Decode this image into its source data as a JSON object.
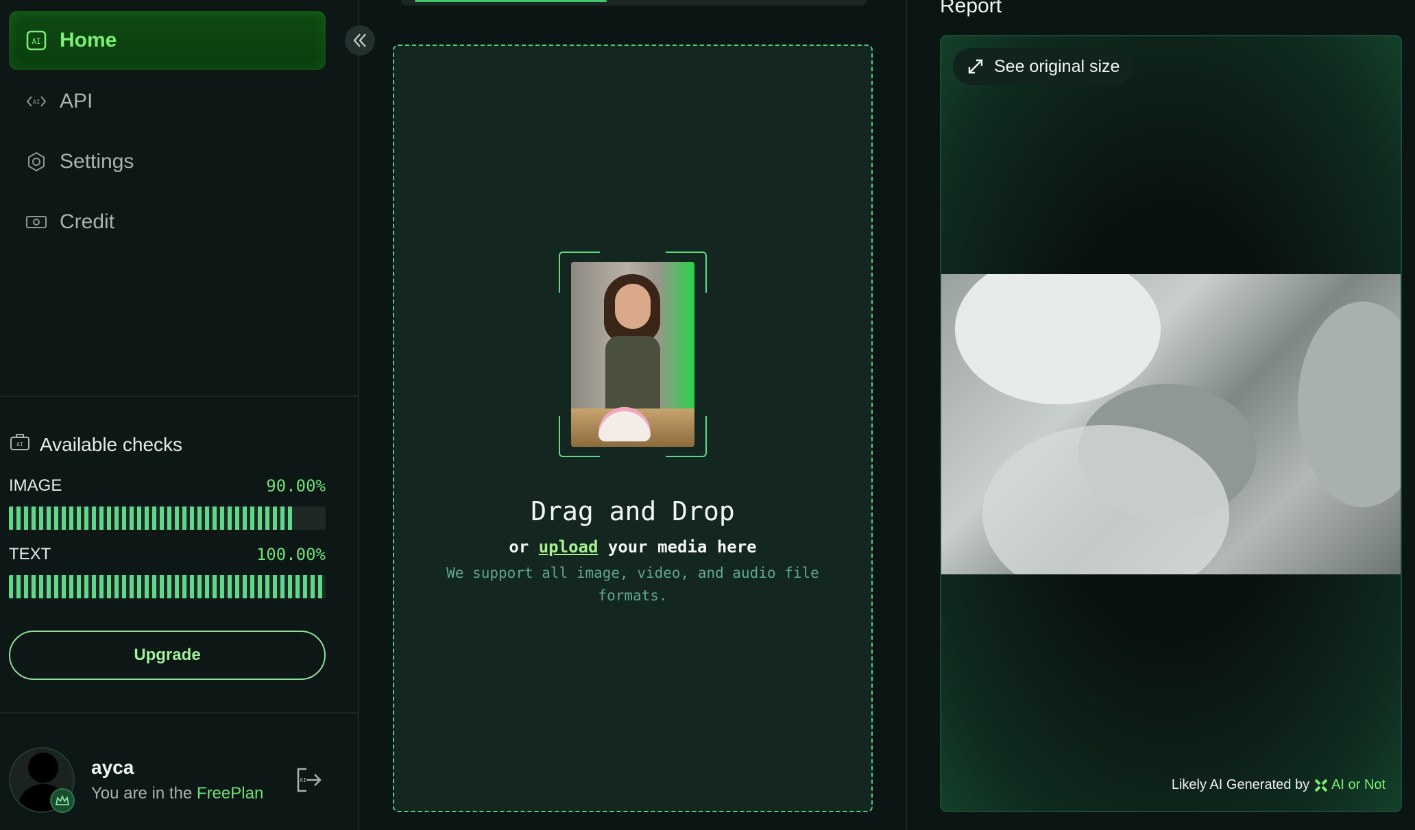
{
  "sidebar": {
    "nav": [
      {
        "label": "Home",
        "icon": "home-scan-icon",
        "active": true
      },
      {
        "label": "API",
        "icon": "api-icon",
        "active": false
      },
      {
        "label": "Settings",
        "icon": "settings-icon",
        "active": false
      },
      {
        "label": "Credit",
        "icon": "credit-icon",
        "active": false
      }
    ],
    "checks": {
      "title": "Available checks",
      "image": {
        "label": "IMAGE",
        "value_text": "90.00%",
        "fraction": 0.9
      },
      "text": {
        "label": "TEXT",
        "value_text": "100.00%",
        "fraction": 1.0
      }
    },
    "upgrade_label": "Upgrade",
    "user": {
      "name": "ayca",
      "plan_prefix": "You are in the ",
      "plan_name": "FreePlan"
    }
  },
  "upload": {
    "title": "Drag and Drop",
    "sub_prefix": "or ",
    "sub_link": "upload",
    "sub_suffix": " your media here",
    "note": "We support all image, video, and audio file formats."
  },
  "report": {
    "title": "Report",
    "original_size_label": "See original size",
    "likely_label": "Likely AI Generated by",
    "brand": "AI or Not"
  },
  "colors": {
    "accent": "#6fe07a",
    "background": "#0b1513",
    "active_nav": "#0f4a12"
  }
}
